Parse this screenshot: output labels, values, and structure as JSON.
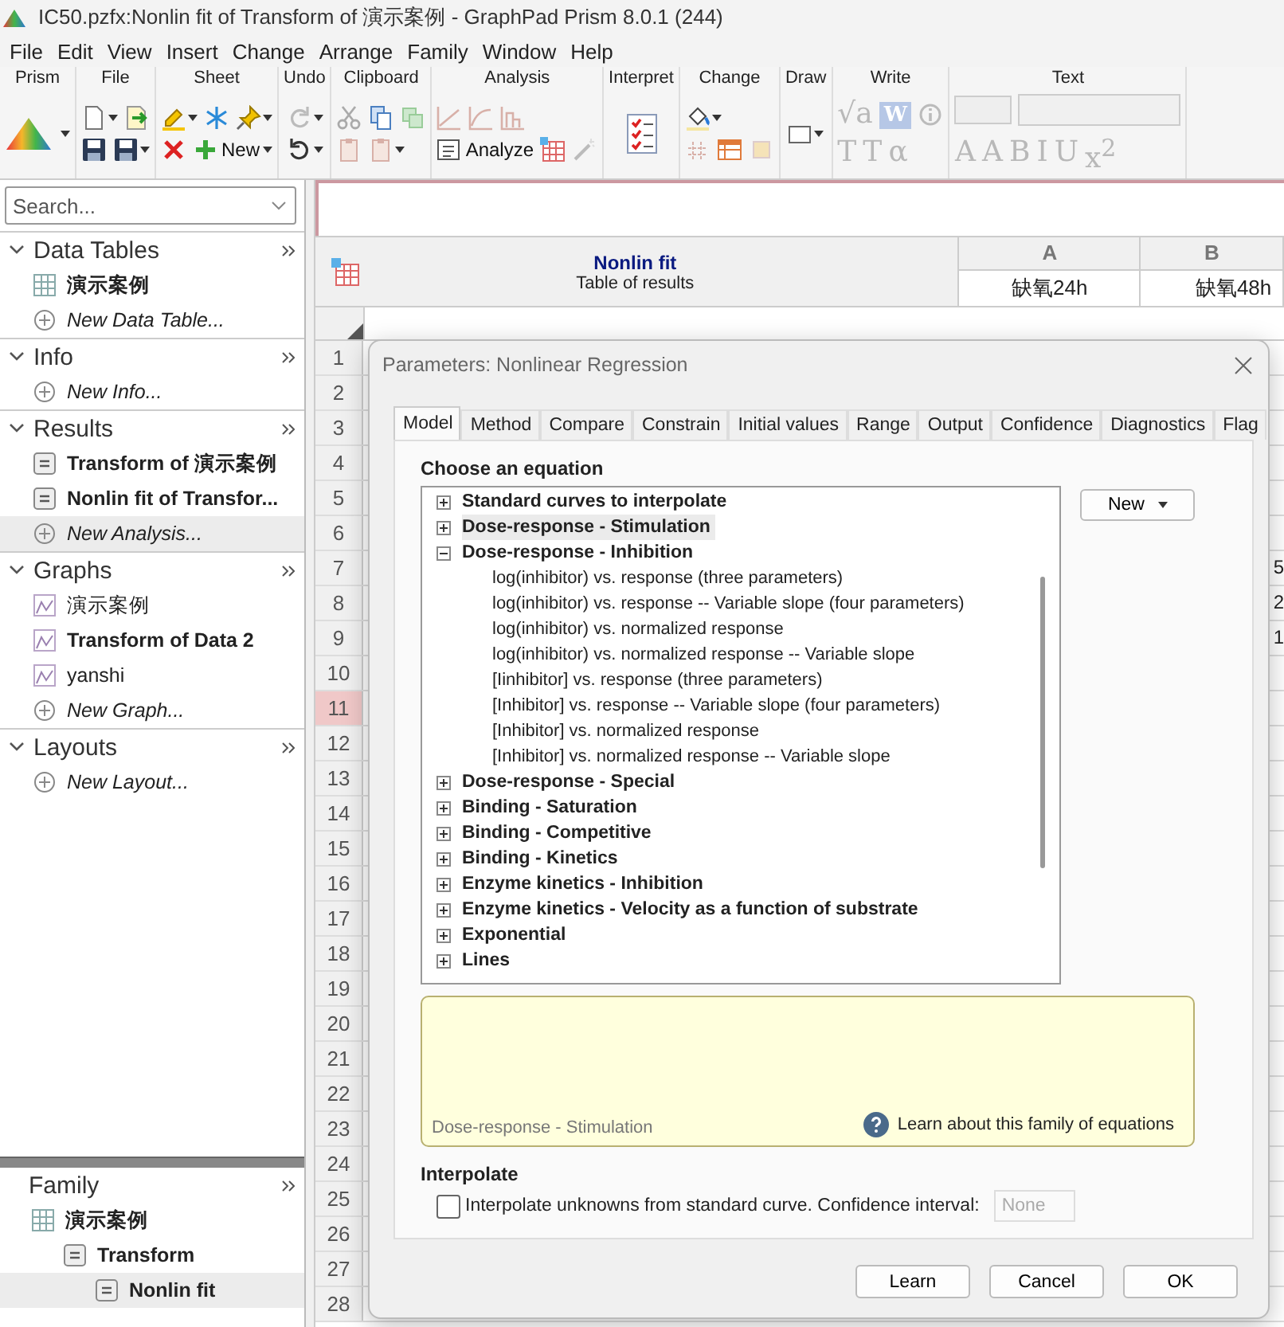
{
  "window": {
    "title": "IC50.pzfx:Nonlin fit of Transform of 演示案例 - GraphPad Prism 8.0.1 (244)"
  },
  "menu": [
    "File",
    "Edit",
    "View",
    "Insert",
    "Change",
    "Arrange",
    "Family",
    "Window",
    "Help"
  ],
  "ribbon": [
    {
      "label": "Prism",
      "top": [
        {
          "kind": "logo",
          "menu": true
        }
      ]
    },
    {
      "label": "File",
      "top": [
        {
          "kind": "doc",
          "menu": true
        },
        {
          "kind": "export"
        }
      ],
      "bottom": [
        {
          "kind": "save"
        },
        {
          "kind": "save",
          "menu": true
        }
      ]
    },
    {
      "label": "Sheet",
      "top": [
        {
          "kind": "marker",
          "menu": true
        },
        {
          "kind": "snow"
        },
        {
          "kind": "pin",
          "menu": true
        }
      ],
      "bottom": [
        {
          "kind": "del"
        },
        {
          "kind": "plus",
          "text": "New",
          "menu": true
        }
      ]
    },
    {
      "label": "Undo",
      "top": [
        {
          "kind": "redo",
          "menu": true
        }
      ],
      "bottom": [
        {
          "kind": "undo",
          "menu": true
        }
      ]
    },
    {
      "label": "Clipboard",
      "top": [
        {
          "kind": "cut"
        },
        {
          "kind": "copy"
        },
        {
          "kind": "pastesp"
        }
      ],
      "bottom": [
        {
          "kind": "clip"
        },
        {
          "kind": "clip",
          "menu": true
        }
      ]
    },
    {
      "label": "Analysis",
      "top": [
        {
          "kind": "linechart"
        },
        {
          "kind": "curve"
        },
        {
          "kind": "barchart"
        }
      ],
      "bottom": [
        {
          "kind": "listdoc",
          "text": "Analyze"
        },
        {
          "kind": "grid"
        },
        {
          "kind": "wand"
        }
      ]
    },
    {
      "label": "Interpret",
      "top": [
        {
          "kind": "checklist"
        }
      ]
    },
    {
      "label": "Change",
      "top": [
        {
          "kind": "bucket",
          "menu": true
        }
      ],
      "bottom": [
        {
          "kind": "hash"
        },
        {
          "kind": "tablecheck"
        },
        {
          "kind": "square"
        }
      ]
    },
    {
      "label": "Draw",
      "top": [
        {
          "kind": "rect",
          "menu": true
        }
      ]
    },
    {
      "label": "Write",
      "top": [
        {
          "kind": "glyph",
          "text": "√a"
        },
        {
          "kind": "boxglyph",
          "text": "W"
        },
        {
          "kind": "info"
        }
      ],
      "bottom": [
        {
          "kind": "glyph",
          "text": "T"
        },
        {
          "kind": "glyph",
          "text": "T"
        },
        {
          "kind": "glyph",
          "text": "α"
        }
      ]
    },
    {
      "label": "Text",
      "top": [
        {
          "kind": "combo"
        },
        {
          "kind": "field"
        }
      ],
      "bottom": [
        {
          "kind": "glyph",
          "text": "A"
        },
        {
          "kind": "glyph",
          "text": "A"
        },
        {
          "kind": "glyph",
          "text": "B"
        },
        {
          "kind": "glyph",
          "text": "I"
        },
        {
          "kind": "glyph",
          "text": "U"
        },
        {
          "kind": "glyph",
          "text": "x$^{2}$"
        }
      ]
    }
  ],
  "sidebar": {
    "search": {
      "placeholder": "Search..."
    },
    "sections": [
      {
        "title": "Data Tables",
        "items": [
          {
            "kind": "table",
            "label": "演示案例",
            "bold": true,
            "selected": false
          },
          {
            "kind": "new",
            "label": "New Data Table...",
            "bold": false,
            "selected": false
          }
        ]
      },
      {
        "title": "Info",
        "items": [
          {
            "kind": "new",
            "label": "New Info...",
            "bold": false,
            "selected": false
          }
        ]
      },
      {
        "title": "Results",
        "items": [
          {
            "kind": "result",
            "label": "Transform of 演示案例",
            "bold": true,
            "selected": false
          },
          {
            "kind": "result",
            "label": "Nonlin fit of Transfor...",
            "bold": true,
            "selected": false
          },
          {
            "kind": "new",
            "label": "New Analysis...",
            "bold": false,
            "selected": true
          }
        ]
      },
      {
        "title": "Graphs",
        "items": [
          {
            "kind": "graph",
            "label": "演示案例",
            "bold": false,
            "selected": false
          },
          {
            "kind": "graph",
            "label": "Transform of Data 2",
            "bold": true,
            "selected": false
          },
          {
            "kind": "graph",
            "label": "yanshi",
            "bold": false,
            "selected": false
          },
          {
            "kind": "new",
            "label": "New Graph...",
            "bold": false,
            "selected": false
          }
        ]
      },
      {
        "title": "Layouts",
        "items": [
          {
            "kind": "new",
            "label": "New Layout...",
            "bold": false,
            "selected": false
          }
        ]
      }
    ]
  },
  "family": {
    "title": "Family",
    "items": [
      {
        "kind": "table",
        "label": "演示案例",
        "selected": false,
        "children": [
          {
            "kind": "result",
            "label": "Transform",
            "selected": false,
            "children": [
              {
                "kind": "result",
                "label": "Nonlin fit",
                "selected": true
              }
            ]
          }
        ]
      }
    ]
  },
  "sheet": {
    "title": "Nonlin fit",
    "subtitle": "Table of results",
    "columns": [
      {
        "letter": "A",
        "title": "缺氧24h"
      },
      {
        "letter": "B",
        "title": "缺氧48h"
      }
    ],
    "rows": [
      {
        "number": "1",
        "selected": false
      },
      {
        "number": "2",
        "selected": false
      },
      {
        "number": "3",
        "selected": false
      },
      {
        "number": "4",
        "selected": false
      },
      {
        "number": "5",
        "selected": false
      },
      {
        "number": "6",
        "selected": false
      },
      {
        "number": "7",
        "selected": false,
        "value": "5"
      },
      {
        "number": "8",
        "selected": false,
        "value": "2"
      },
      {
        "number": "9",
        "selected": false,
        "value": "1"
      },
      {
        "number": "10",
        "selected": false
      },
      {
        "number": "11",
        "selected": true
      },
      {
        "number": "12",
        "selected": false
      },
      {
        "number": "13",
        "selected": false
      },
      {
        "number": "14",
        "selected": false
      },
      {
        "number": "15",
        "selected": false
      },
      {
        "number": "16",
        "selected": false
      },
      {
        "number": "17",
        "selected": false
      },
      {
        "number": "18",
        "selected": false
      },
      {
        "number": "19",
        "selected": false
      },
      {
        "number": "20",
        "selected": false
      },
      {
        "number": "21",
        "selected": false
      },
      {
        "number": "22",
        "selected": false
      },
      {
        "number": "23",
        "selected": false
      },
      {
        "number": "24",
        "selected": false
      },
      {
        "number": "25",
        "selected": false
      },
      {
        "number": "26",
        "selected": false
      },
      {
        "number": "27",
        "selected": false
      },
      {
        "number": "28",
        "selected": false
      }
    ]
  },
  "dialog": {
    "title": "Parameters: Nonlinear Regression",
    "tabs": [
      {
        "label": "Model",
        "selected": true
      },
      {
        "label": "Method",
        "selected": false
      },
      {
        "label": "Compare",
        "selected": false
      },
      {
        "label": "Constrain",
        "selected": false
      },
      {
        "label": "Initial values",
        "selected": false
      },
      {
        "label": "Range",
        "selected": false
      },
      {
        "label": "Output",
        "selected": false
      },
      {
        "label": "Confidence",
        "selected": false
      },
      {
        "label": "Diagnostics",
        "selected": false
      },
      {
        "label": "Flag",
        "selected": false
      }
    ],
    "heading": "Choose an equation",
    "equations": [
      {
        "label": "Standard curves to interpolate",
        "expanded": false,
        "selected": false
      },
      {
        "label": "Dose-response - Stimulation",
        "expanded": false,
        "selected": true
      },
      {
        "label": "Dose-response - Inhibition",
        "expanded": true,
        "selected": false,
        "children": [
          {
            "label": "log(inhibitor) vs. response (three parameters)",
            "selected": false
          },
          {
            "label": "log(inhibitor) vs. response -- Variable slope (four parameters)",
            "selected": false
          },
          {
            "label": "log(inhibitor) vs. normalized response",
            "selected": false
          },
          {
            "label": "log(inhibitor) vs. normalized response -- Variable slope",
            "selected": false
          },
          {
            "label": "[Iinhibitor] vs. response (three parameters)",
            "selected": false
          },
          {
            "label": "[Inhibitor] vs. response -- Variable slope (four parameters)",
            "selected": false
          },
          {
            "label": "[Inhibitor] vs. normalized response",
            "selected": false
          },
          {
            "label": "[Inhibitor] vs. normalized response -- Variable slope",
            "selected": false
          }
        ]
      },
      {
        "label": "Dose-response - Special",
        "expanded": false,
        "selected": false
      },
      {
        "label": "Binding - Saturation",
        "expanded": false,
        "selected": false
      },
      {
        "label": "Binding - Competitive",
        "expanded": false,
        "selected": false
      },
      {
        "label": "Binding - Kinetics",
        "expanded": false,
        "selected": false
      },
      {
        "label": "Enzyme kinetics - Inhibition",
        "expanded": false,
        "selected": false
      },
      {
        "label": "Enzyme kinetics - Velocity as a function of substrate",
        "expanded": false,
        "selected": false
      },
      {
        "label": "Exponential",
        "expanded": false,
        "selected": false
      },
      {
        "label": "Lines",
        "expanded": false,
        "selected": false
      }
    ],
    "new_button": "New",
    "description": {
      "family": "Dose-response - Stimulation",
      "help": "Learn about this family of equations"
    },
    "interpolate": {
      "heading": "Interpolate",
      "label": "Interpolate unknowns from standard curve. Confidence interval:",
      "checked": false,
      "select": "None"
    },
    "buttons": [
      "Learn",
      "Cancel",
      "OK"
    ]
  }
}
